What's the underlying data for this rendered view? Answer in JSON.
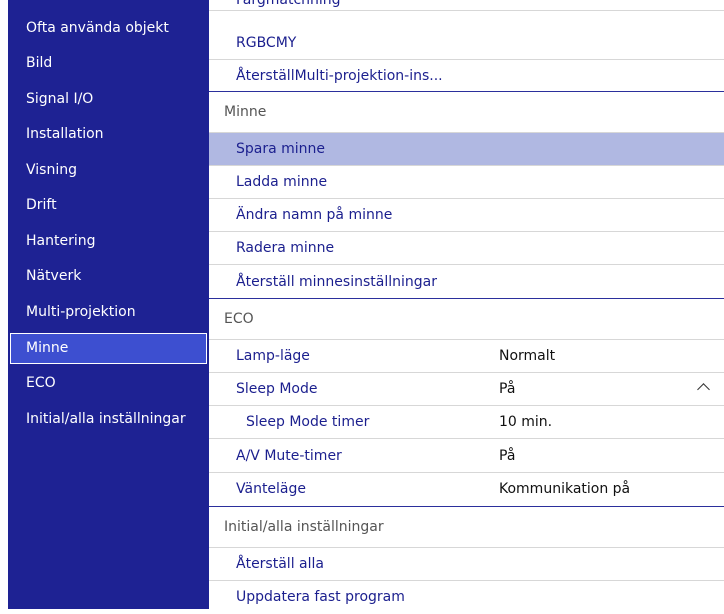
{
  "sidebar": {
    "items": [
      {
        "label": "Ofta använda objekt"
      },
      {
        "label": "Bild"
      },
      {
        "label": "Signal I/O"
      },
      {
        "label": "Installation"
      },
      {
        "label": "Visning"
      },
      {
        "label": "Drift"
      },
      {
        "label": "Hantering"
      },
      {
        "label": "Nätverk"
      },
      {
        "label": "Multi-projektion"
      },
      {
        "label": "Minne",
        "selected": true
      },
      {
        "label": "ECO"
      },
      {
        "label": "Initial/alla inställningar"
      }
    ]
  },
  "main": {
    "partial_top": "Färgmatchning",
    "multi": {
      "rows": [
        {
          "label": "RGBCMY"
        },
        {
          "label": "ÅterställMulti-projektion-ins..."
        }
      ]
    },
    "memory": {
      "title": "Minne",
      "rows": [
        {
          "label": "Spara minne"
        },
        {
          "label": "Ladda minne"
        },
        {
          "label": "Ändra namn på minne"
        },
        {
          "label": "Radera minne"
        },
        {
          "label": "Återställ minnesinställningar"
        }
      ]
    },
    "eco": {
      "title": "ECO",
      "rows": [
        {
          "label": "Lamp-läge",
          "value": "Normalt"
        },
        {
          "label": "Sleep Mode",
          "value": "På"
        },
        {
          "label": "Sleep Mode timer",
          "value": "10 min."
        },
        {
          "label": "A/V Mute-timer",
          "value": "På"
        },
        {
          "label": "Vänteläge",
          "value": "Kommunikation på"
        }
      ]
    },
    "initial": {
      "title": "Initial/alla inställningar",
      "rows": [
        {
          "label": "Återställ alla"
        },
        {
          "label": "Uppdatera fast program"
        }
      ]
    }
  },
  "colors": {
    "sidebar_bg": "#1e2293",
    "selected_bg": "#3d4fd0",
    "highlight_row": "#b0b8e2",
    "text_blue": "#1b1f8e"
  },
  "icons": {
    "sleep_mode_chevron": "chevron-up-icon"
  }
}
